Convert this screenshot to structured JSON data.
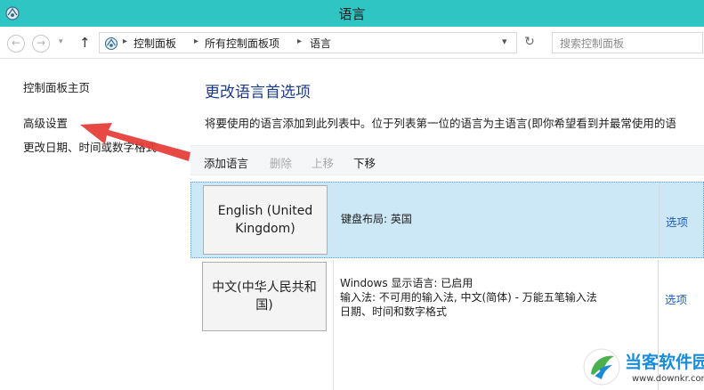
{
  "window": {
    "title": "语言"
  },
  "address": {
    "crumbs": [
      "控制面板",
      "所有控制面板项",
      "语言"
    ],
    "search_placeholder": "搜索控制面板",
    "back_glyph": "←",
    "forward_glyph": "→",
    "up_glyph": "↑",
    "dropdown_glyph": "▾",
    "separator_glyph": "▸",
    "refresh_glyph": "↻"
  },
  "sidebar": {
    "items": [
      {
        "label": "控制面板主页"
      },
      {
        "label": "高级设置"
      },
      {
        "label": "更改日期、时间或数字格式"
      }
    ]
  },
  "main": {
    "title": "更改语言首选项",
    "description": "将要使用的语言添加到此列表中。位于列表第一位的语言为主语言(即你希望看到并最常使用的语"
  },
  "toolbar": {
    "add_label": "添加语言",
    "remove_label": "删除",
    "up_label": "上移",
    "down_label": "下移"
  },
  "languages": [
    {
      "name": "English (United Kingdom)",
      "details": [
        "键盘布局: 英国"
      ],
      "options_label": "选项",
      "selected": true
    },
    {
      "name": "中文(中华人民共和国)",
      "details": [
        "Windows 显示语言: 已启用",
        "输入法: 不可用的输入法, 中文(简体) - 万能五笔输入法",
        "日期、时间和数字格式"
      ],
      "options_label": "选项",
      "selected": false
    }
  ],
  "watermark": {
    "brand": "当客软件园",
    "url": "www.downkr.com"
  },
  "colors": {
    "titlebar": "#2ec5c2",
    "heading": "#1e3c8c",
    "link": "#1f5fb4",
    "selected_row": "#cce8f6",
    "annotation_arrow": "#e53935",
    "watermark_brand": "#1a8bd6"
  },
  "icons": [
    "control-panel-icon",
    "back-arrow-icon",
    "forward-arrow-icon",
    "up-arrow-icon",
    "refresh-icon",
    "annotation-arrow",
    "watermark-logo"
  ]
}
